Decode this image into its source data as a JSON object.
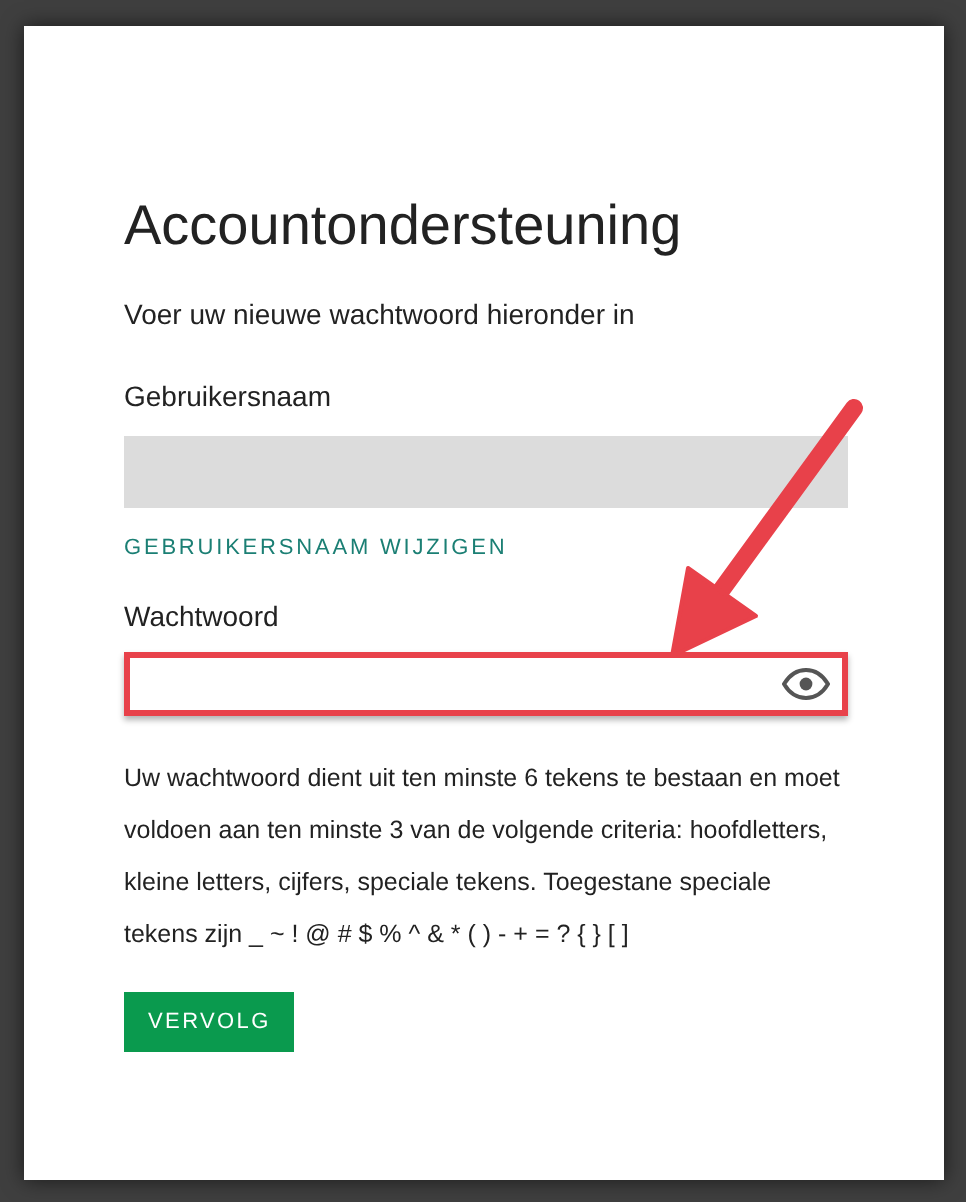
{
  "title": "Accountondersteuning",
  "subtitle": "Voer uw nieuwe wachtwoord hieronder in",
  "username": {
    "label": "Gebruikersnaam",
    "disabled": true
  },
  "change_username_link": "GEBRUIKERSNAAM WIJZIGEN",
  "password": {
    "label": "Wachtwoord",
    "highlighted": true
  },
  "help_text": "Uw wachtwoord dient uit ten minste 6 tekens te bestaan en moet voldoen aan ten minste 3 van de volgende criteria: hoofdletters, kleine letters, cijfers, speciale tekens. Toegestane speciale tekens zijn _ ~ ! @ # $ % ^ & * ( ) - + = ? { } [ ]",
  "button": "VERVOLG"
}
